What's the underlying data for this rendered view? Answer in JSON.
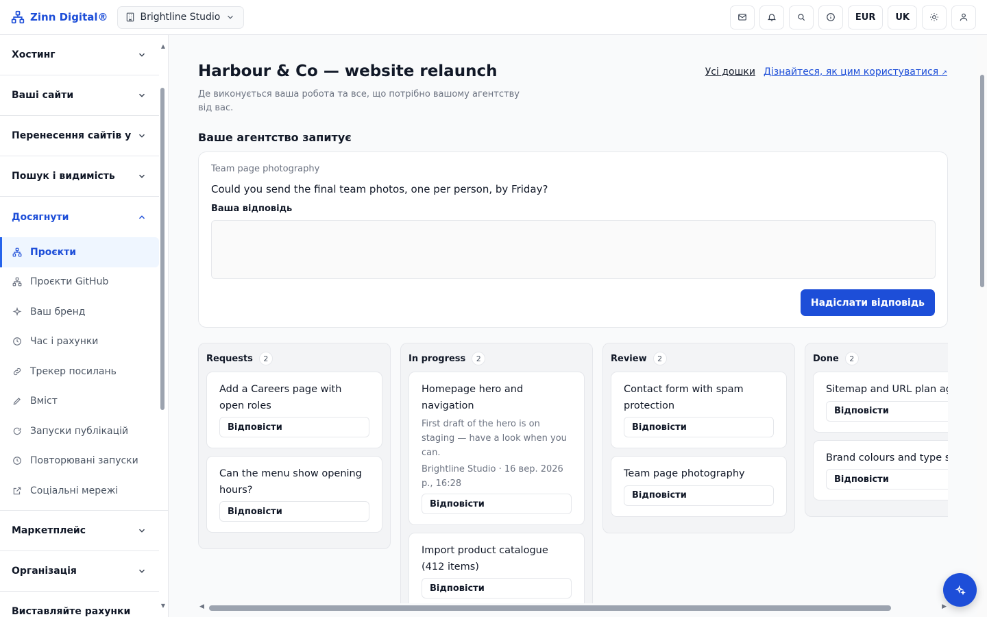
{
  "brand": {
    "name": "Zinn Digital®"
  },
  "workspace": {
    "name": "Brightline Studio"
  },
  "top_actions": {
    "currency": "EUR",
    "language": "UK"
  },
  "sidebar": {
    "sections": [
      {
        "label": "Хостинг"
      },
      {
        "label": "Ваші сайти"
      },
      {
        "label": "Перенесення сайтів у"
      },
      {
        "label": "Пошук і видимість"
      },
      {
        "label": "Досягнути"
      }
    ],
    "sub_items": [
      {
        "label": "Проєкти"
      },
      {
        "label": "Проєкти GitHub"
      },
      {
        "label": "Ваш бренд"
      },
      {
        "label": "Час і рахунки"
      },
      {
        "label": "Трекер посилань"
      },
      {
        "label": "Вміст"
      },
      {
        "label": "Запуски публікацій"
      },
      {
        "label": "Повторювані запуски"
      },
      {
        "label": "Соціальні мережі"
      }
    ],
    "bottom_sections": [
      {
        "label": "Маркетплейс"
      },
      {
        "label": "Організація"
      },
      {
        "label": "Виставляйте рахунки"
      }
    ]
  },
  "page": {
    "title": "Harbour & Co — website relaunch",
    "description": "Де виконується ваша робота та все, що потрібно вашому агентству від вас.",
    "link_all_boards": "Усі дошки",
    "link_learn": "Дізнайтеся, як цим користуватися"
  },
  "request_section": {
    "heading": "Ваше агентство запитує",
    "topic": "Team page photography",
    "question": "Could you send the final team photos, one per person, by Friday?",
    "reply_label": "Ваша відповідь",
    "reply_value": "",
    "send_label": "Надіслати відповідь"
  },
  "board": {
    "reply_label": "Відповісти",
    "columns": [
      {
        "title": "Requests",
        "count": "2",
        "cards": [
          {
            "title": "Add a Careers page with open roles"
          },
          {
            "title": "Can the menu show opening hours?"
          }
        ]
      },
      {
        "title": "In progress",
        "count": "2",
        "cards": [
          {
            "title": "Homepage hero and navigation",
            "note": "First draft of the hero is on staging — have a look when you can.",
            "meta": "Brightline Studio · 16 вер. 2026 р., 16:28"
          },
          {
            "title": "Import product catalogue (412 items)"
          }
        ]
      },
      {
        "title": "Review",
        "count": "2",
        "cards": [
          {
            "title": "Contact form with spam protection"
          },
          {
            "title": "Team page photography"
          }
        ]
      },
      {
        "title": "Done",
        "count": "2",
        "cards": [
          {
            "title": "Sitemap and URL plan agreed"
          },
          {
            "title": "Brand colours and type scale"
          }
        ]
      }
    ]
  },
  "colors": {
    "accent": "#1d4ed8",
    "border": "#e5e7eb"
  }
}
